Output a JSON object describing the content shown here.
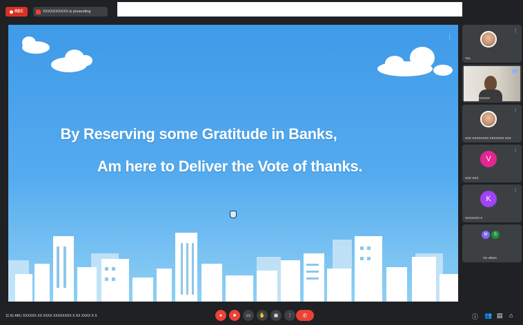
{
  "topbar": {
    "rec_label": "REC",
    "presenting_label": "XXXXXXXXXX is presenting"
  },
  "slide": {
    "line1": "By Reserving some Gratitude in Banks,",
    "line2": "Am here to Deliver  the Vote of thanks.",
    "sky_color": "#4aa3ec"
  },
  "participants": [
    {
      "name": "You",
      "type": "photo"
    },
    {
      "name": "XXXXXXXXXXXX",
      "type": "video"
    },
    {
      "name": "XXX XXXXXXXX XXXXXXX XXX",
      "type": "photo"
    },
    {
      "name": "XXX XXX",
      "type": "letter",
      "letter": "V",
      "color": "#e52592"
    },
    {
      "name": "XXXXXXX X",
      "type": "letter",
      "letter": "K",
      "color": "#a142f4"
    },
    {
      "name": "XX others",
      "type": "group",
      "letters": [
        "M",
        "S"
      ],
      "colors": [
        "#7b68ee",
        "#1e8e3e"
      ]
    }
  ],
  "bottombar": {
    "meeting_info": "11:51 AM  |  XXXXXX XX XXXX XXXXXXXX X XX XXXX X X",
    "controls": [
      "mic-off",
      "camera-off",
      "captions",
      "raise-hand",
      "present",
      "more",
      "end-call"
    ]
  }
}
